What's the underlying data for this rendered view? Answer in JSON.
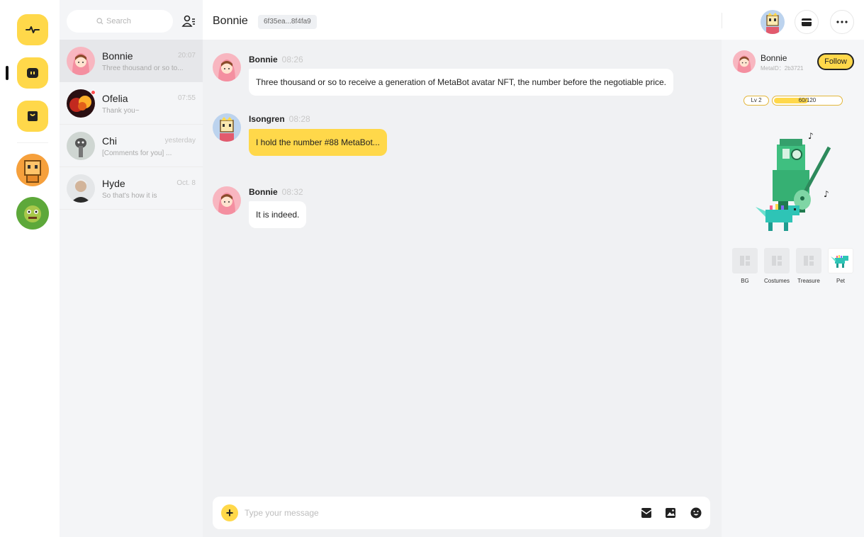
{
  "colors": {
    "accent": "#ffd84a",
    "sidebar_bg": "#f4f5f7",
    "chat_bg": "#f0f1f3",
    "bubble_white": "#ffffff",
    "unread": "#ff4d4f"
  },
  "rail": {
    "items": [
      {
        "icon": "activity-icon"
      },
      {
        "icon": "chat-icon",
        "active": true
      },
      {
        "icon": "bag-icon"
      }
    ],
    "avatars": [
      {
        "icon": "metabot-avatar"
      },
      {
        "icon": "monster-avatar"
      }
    ]
  },
  "sidebar": {
    "search": {
      "placeholder": "Search"
    },
    "conversations": [
      {
        "name": "Bonnie",
        "time": "20:07",
        "preview": "Three thousand or so to...",
        "active": true
      },
      {
        "name": "Ofelia",
        "time": "07:55",
        "preview": "Thank you~",
        "unread": true
      },
      {
        "name": "Chi",
        "time": "yesterday",
        "preview": "[Comments for you] ..."
      },
      {
        "name": "Hyde",
        "time": "Oct. 8",
        "preview": "So that's how it is"
      }
    ]
  },
  "chat": {
    "title": "Bonnie",
    "address": "6f35ea...8f4fa9",
    "messages": [
      {
        "sender": "Bonnie",
        "time": "08:26",
        "text": "Three thousand or so to receive a generation of MetaBot avatar NFT, the number before the negotiable price.",
        "style": "white"
      },
      {
        "sender": "Isongren",
        "time": "08:28",
        "text": "I hold the number #88 MetaBot...",
        "style": "yellow"
      },
      {
        "sender": "Bonnie",
        "time": "08:32",
        "text": "It is indeed.",
        "style": "white"
      }
    ],
    "input": {
      "placeholder": "Type your message"
    }
  },
  "profile": {
    "name": "Bonnie",
    "meta_id": "MetaID：2b3721",
    "follow_label": "Follow",
    "level": "Lv 2",
    "xp_text": "60/120",
    "xp_fraction": 0.5,
    "slots": [
      {
        "label": "BG"
      },
      {
        "label": "Costumes"
      },
      {
        "label": "Treasure"
      },
      {
        "label": "Pet"
      }
    ]
  }
}
